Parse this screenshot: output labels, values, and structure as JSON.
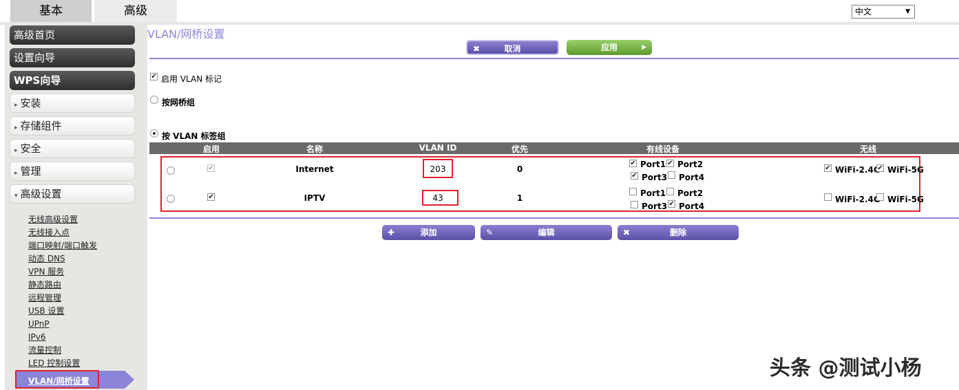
{
  "tabs": {
    "basic": "基本",
    "advanced": "高级"
  },
  "language": {
    "selected": "中文",
    "arrow": "▼"
  },
  "sidebar": {
    "dark_items": [
      "高级首页",
      "设置向导",
      "WPS向导"
    ],
    "light_items": [
      {
        "label": "安装",
        "marker": "▸"
      },
      {
        "label": "存储组件",
        "marker": "▸"
      },
      {
        "label": "安全",
        "marker": "▸"
      },
      {
        "label": "管理",
        "marker": "▸"
      },
      {
        "label": "高级设置",
        "marker": "▾"
      }
    ],
    "sub_links": [
      "无线高级设置",
      "无线接入点",
      "端口映射/端口触发",
      "动态 DNS",
      "VPN 服务",
      "静态路由",
      "远程管理",
      "USB 设置",
      "UPnP",
      "IPv6",
      "流量控制",
      "LED 控制设置"
    ],
    "active_link": "VLAN/网桥设置"
  },
  "main": {
    "title": "VLAN/网桥设置",
    "cancel_label": "取消",
    "apply_label": "应用",
    "enable_vlan_label": "启用 VLAN 标记",
    "bridge_group_label": "按网桥组",
    "vlan_group_label": "按 VLAN 标签组",
    "columns": [
      "启用",
      "名称",
      "VLAN ID",
      "优先",
      "有线设备",
      "无线"
    ],
    "rows": [
      {
        "name": "Internet",
        "vlan_id": "203",
        "priority": "0",
        "ports": [
          {
            "label": "Port1",
            "checked": true
          },
          {
            "label": "Port2",
            "checked": true
          },
          {
            "label": "Port3",
            "checked": true
          },
          {
            "label": "Port4",
            "checked": false
          }
        ],
        "wifi": [
          {
            "label": "WiFi-2.4G",
            "checked": true
          },
          {
            "label": "WiFi-5G",
            "checked": true
          }
        ]
      },
      {
        "name": "IPTV",
        "vlan_id": "43",
        "priority": "1",
        "ports": [
          {
            "label": "Port1",
            "checked": false
          },
          {
            "label": "Port2",
            "checked": false
          },
          {
            "label": "Port3",
            "checked": false
          },
          {
            "label": "Port4",
            "checked": true
          }
        ],
        "wifi": [
          {
            "label": "WiFi-2.4G",
            "checked": false
          },
          {
            "label": "WiFi-5G",
            "checked": false
          }
        ]
      }
    ],
    "add_label": "添加",
    "edit_label": "编辑",
    "delete_label": "删除"
  },
  "watermark": "头条 @测试小杨",
  "icons": {
    "check": "✔",
    "close": "✖",
    "plus": "✚",
    "pencil": "✎",
    "play": "▶"
  }
}
